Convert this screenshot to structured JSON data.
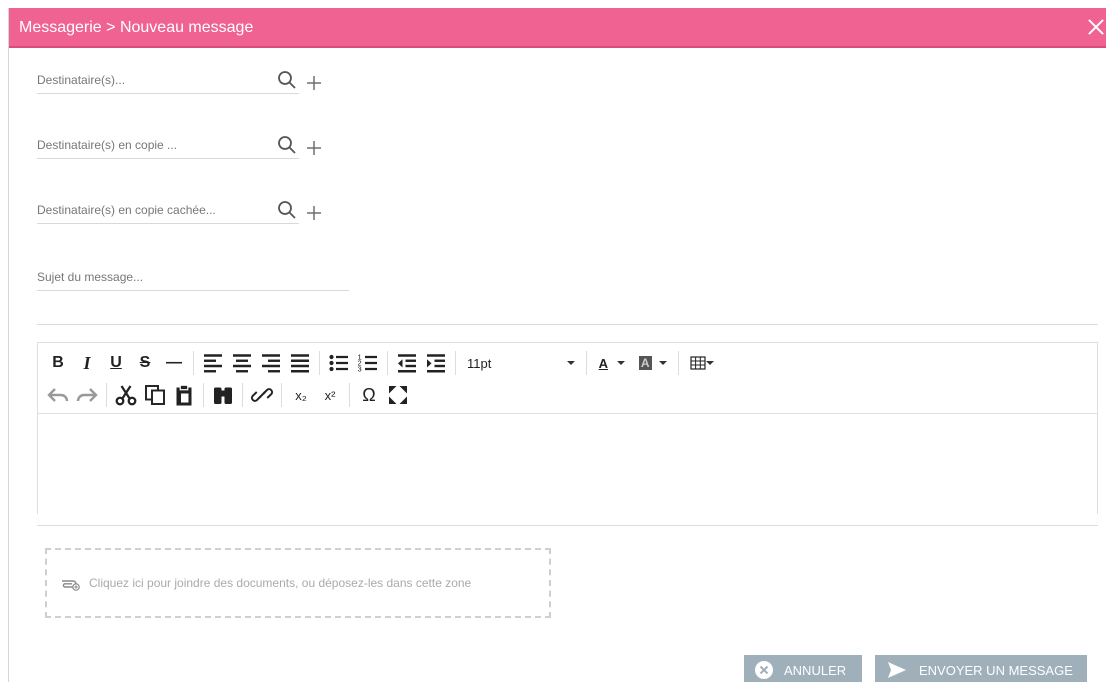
{
  "window": {
    "title": "Messagerie > Nouveau message",
    "accent": "#f06292"
  },
  "fields": {
    "to_placeholder": "Destinataire(s)...",
    "cc_placeholder": "Destinataire(s) en copie ...",
    "bcc_placeholder": "Destinataire(s) en copie cachée...",
    "subject_placeholder": "Sujet du message..."
  },
  "toolbar": {
    "bold": "B",
    "italic": "I",
    "underline": "U",
    "strike": "S",
    "hr": "—",
    "font_size": "11pt",
    "font_color_letter": "A",
    "bg_color_letter": "A",
    "omega": "Ω",
    "subscript": "x₂",
    "superscript": "x²"
  },
  "attachments": {
    "hint": "Cliquez ici pour joindre des documents, ou déposez-les dans cette zone"
  },
  "actions": {
    "cancel": "ANNULER",
    "send": "ENVOYER UN MESSAGE"
  }
}
